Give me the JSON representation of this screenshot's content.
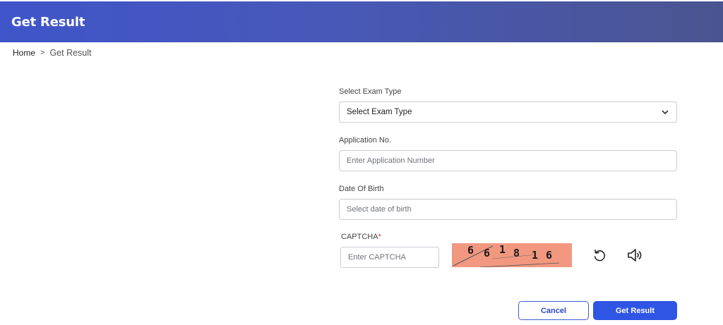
{
  "header": {
    "title": "Get Result"
  },
  "breadcrumb": {
    "home": "Home",
    "separator": ">",
    "current": "Get Result"
  },
  "form": {
    "exam_type": {
      "label": "Select Exam Type",
      "value": "Select Exam Type",
      "icon": "chevron-down-icon"
    },
    "application_no": {
      "label": "Application No.",
      "placeholder": "Enter Application Number",
      "value": ""
    },
    "date_of_birth": {
      "label": "Date Of Birth",
      "placeholder": "Select date of birth",
      "value": ""
    },
    "captcha": {
      "label": "CAPTCHA",
      "required_mark": "*",
      "placeholder": "Enter CAPTCHA",
      "value": "",
      "image_text": [
        "6",
        "6",
        "1",
        "8",
        "1",
        "6"
      ],
      "refresh_icon": "refresh-icon",
      "audio_icon": "speaker-icon"
    }
  },
  "actions": {
    "cancel_label": "Cancel",
    "submit_label": "Get Result"
  },
  "colors": {
    "header_start": "#3f55c9",
    "header_end": "#4a5590",
    "primary": "#2f55e4",
    "captcha_bg": "#f29880",
    "required": "#dd3333"
  }
}
